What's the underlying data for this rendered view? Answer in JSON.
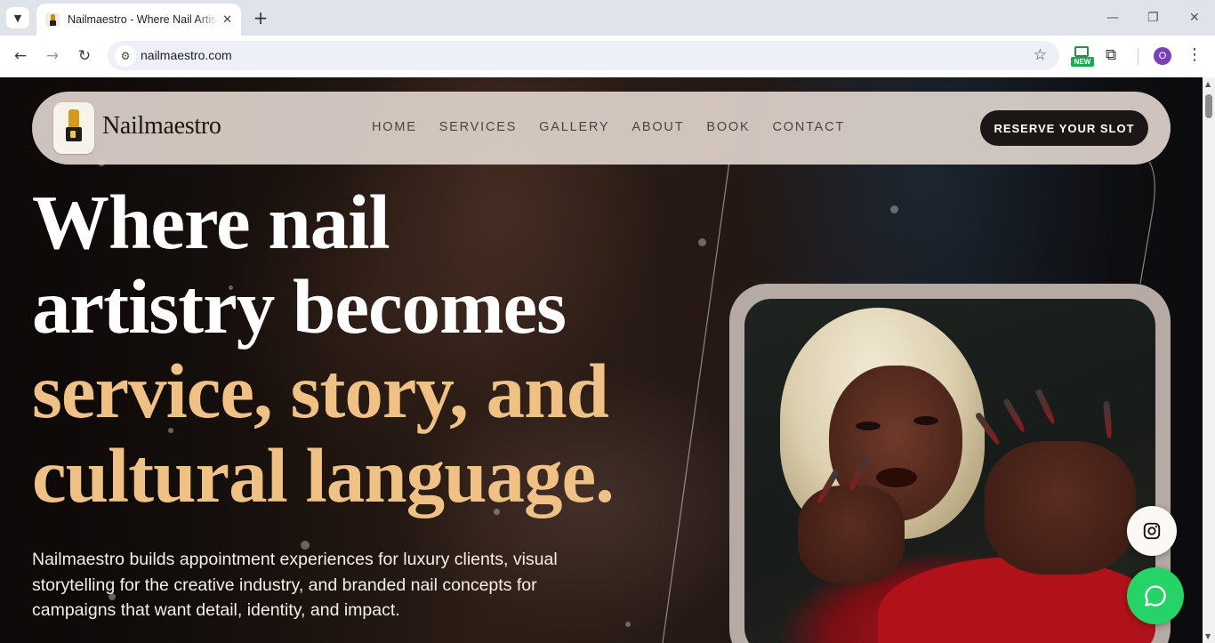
{
  "browser": {
    "tab_title": "Nailmaestro - Where Nail Artistry",
    "url": "nailmaestro.com",
    "extension_badge": "NEW",
    "profile_initial": "O"
  },
  "site": {
    "brand": "Nailmaestro",
    "nav": [
      "HOME",
      "SERVICES",
      "GALLERY",
      "ABOUT",
      "BOOK",
      "CONTACT"
    ],
    "cta": "RESERVE YOUR SLOT"
  },
  "hero": {
    "headline_lines": [
      {
        "text": "Where nail",
        "color": "#ffffff"
      },
      {
        "text": "artistry becomes",
        "color": "#ffffff"
      },
      {
        "text": "service, story, and",
        "color": "#f0c184"
      },
      {
        "text": "cultural language.",
        "color": "#f0c184"
      }
    ],
    "lede": "Nailmaestro builds appointment experiences for luxury clients, visual storytelling for the creative industry, and branded nail concepts for campaigns that want detail, identity, and impact."
  },
  "floating": {
    "instagram_icon": "instagram-icon",
    "chat_icon": "whatsapp-chat-icon"
  },
  "colors": {
    "accent_gold": "#f0c184",
    "header_bg": "#ded4cc",
    "cta_bg": "#1c1716",
    "whatsapp_green": "#25d366"
  }
}
